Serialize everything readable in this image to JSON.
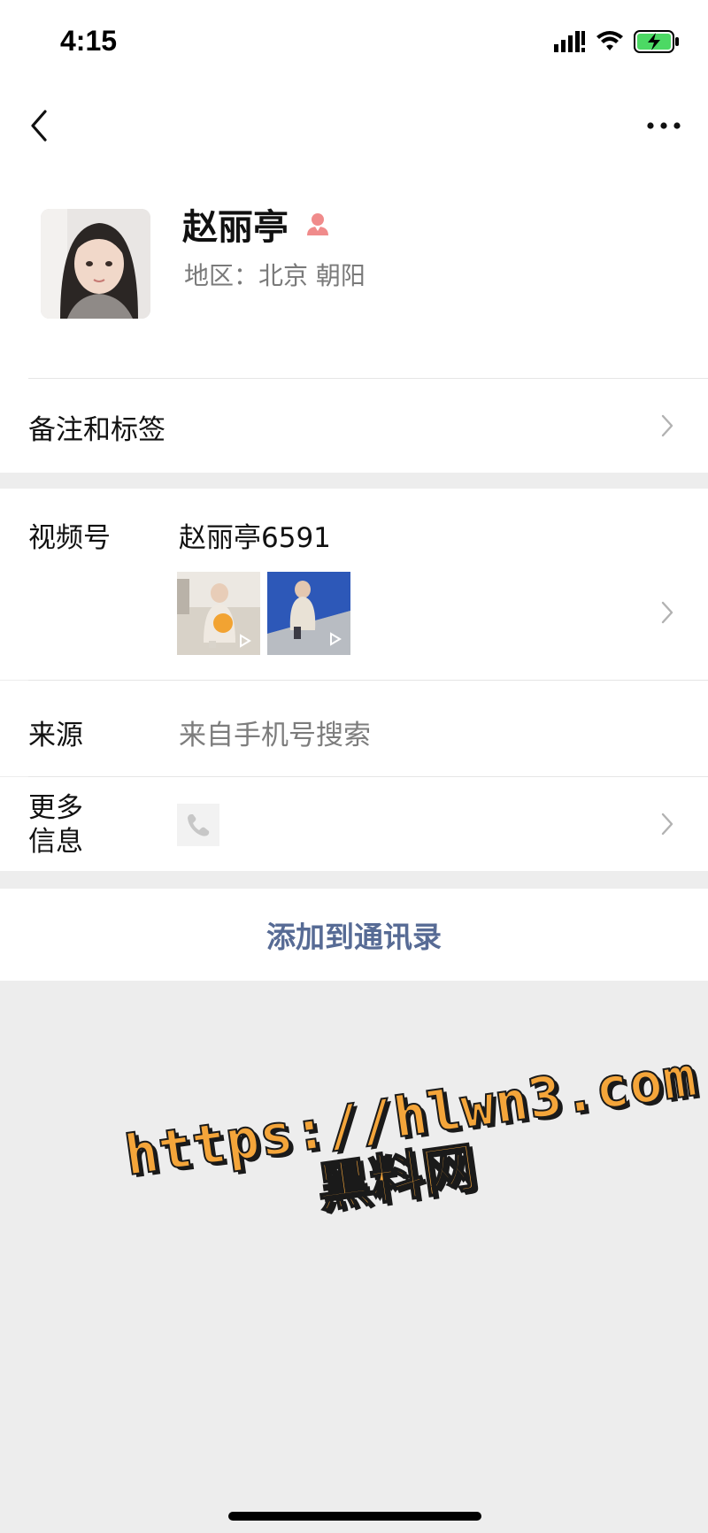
{
  "status_bar": {
    "time": "4:15",
    "icons": [
      "signal-icon",
      "wifi-icon",
      "battery-charging-icon"
    ]
  },
  "nav": {
    "back_icon": "chevron-left-icon",
    "more_icon": "ellipsis-icon"
  },
  "profile": {
    "name": "赵丽亭",
    "gender_icon": "female-person-icon",
    "region": "地区：北京 朝阳"
  },
  "rows": {
    "remarks_label": "备注和标签",
    "channels_label": "视频号",
    "channels_value": "赵丽亭6591",
    "source_label": "来源",
    "source_value": "来自手机号搜索",
    "more_info_label_line1": "更多",
    "more_info_label_line2": "信息"
  },
  "actions": {
    "add_to_contacts": "添加到通讯录"
  },
  "watermark": {
    "line1": "https://hlwn3.com",
    "line2": "黑料网"
  },
  "colors": {
    "link_blue": "#576b95",
    "background_gray": "#ededed",
    "watermark_orange": "#f4a53a",
    "gender_icon_red": "#f08b8b"
  }
}
